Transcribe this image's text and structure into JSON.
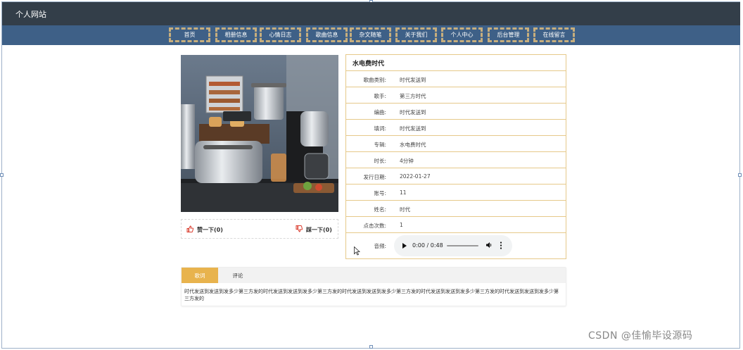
{
  "site": {
    "title": "个人网站"
  },
  "nav": {
    "items": [
      {
        "label": "首页",
        "name": "nav-item-home"
      },
      {
        "label": "相册信息",
        "name": "nav-item-albums"
      },
      {
        "label": "心情日志",
        "name": "nav-item-mood-log"
      },
      {
        "label": "歌曲信息",
        "name": "nav-item-songs"
      },
      {
        "label": "杂文随笔",
        "name": "nav-item-essays"
      },
      {
        "label": "关于我们",
        "name": "nav-item-about"
      },
      {
        "label": "个人中心",
        "name": "nav-item-profile"
      },
      {
        "label": "后台管理",
        "name": "nav-item-admin"
      },
      {
        "label": "在线留言",
        "name": "nav-item-messages"
      }
    ]
  },
  "vote": {
    "like_label": "赞一下(0)",
    "dislike_label": "踩一下(0)"
  },
  "song": {
    "title": "水电费时代",
    "fields": [
      {
        "label": "歌曲类别:",
        "value": "时代发送到"
      },
      {
        "label": "歌手:",
        "value": "第三方时代"
      },
      {
        "label": "编曲:",
        "value": "时代发送到"
      },
      {
        "label": "填词:",
        "value": "时代发送到"
      },
      {
        "label": "专辑:",
        "value": "水电费时代"
      },
      {
        "label": "时长:",
        "value": "4分钟"
      },
      {
        "label": "发行日期:",
        "value": "2022-01-27"
      },
      {
        "label": "账号:",
        "value": "11"
      },
      {
        "label": "姓名:",
        "value": "时代"
      },
      {
        "label": "点击次数:",
        "value": "1"
      }
    ],
    "audio_label": "音频:",
    "player": {
      "time": "0:00 / 0:48"
    }
  },
  "tabs": {
    "items": [
      {
        "label": "歌词"
      },
      {
        "label": "评论"
      }
    ],
    "active_index": 0,
    "lyrics": "时代发送到发送到发多少第三方发的时代发送到发送到发多少第三方发的时代发送到发送到发多少第三方发的时代发送到发送到发多少第三方发的时代发送到发送到发多少第三方发的"
  },
  "watermark": "CSDN @佳愉毕设源码",
  "colors": {
    "topbar": "#333e49",
    "navbar": "#3e6087",
    "accent": "#e8b34d",
    "border": "#e6c98a"
  }
}
